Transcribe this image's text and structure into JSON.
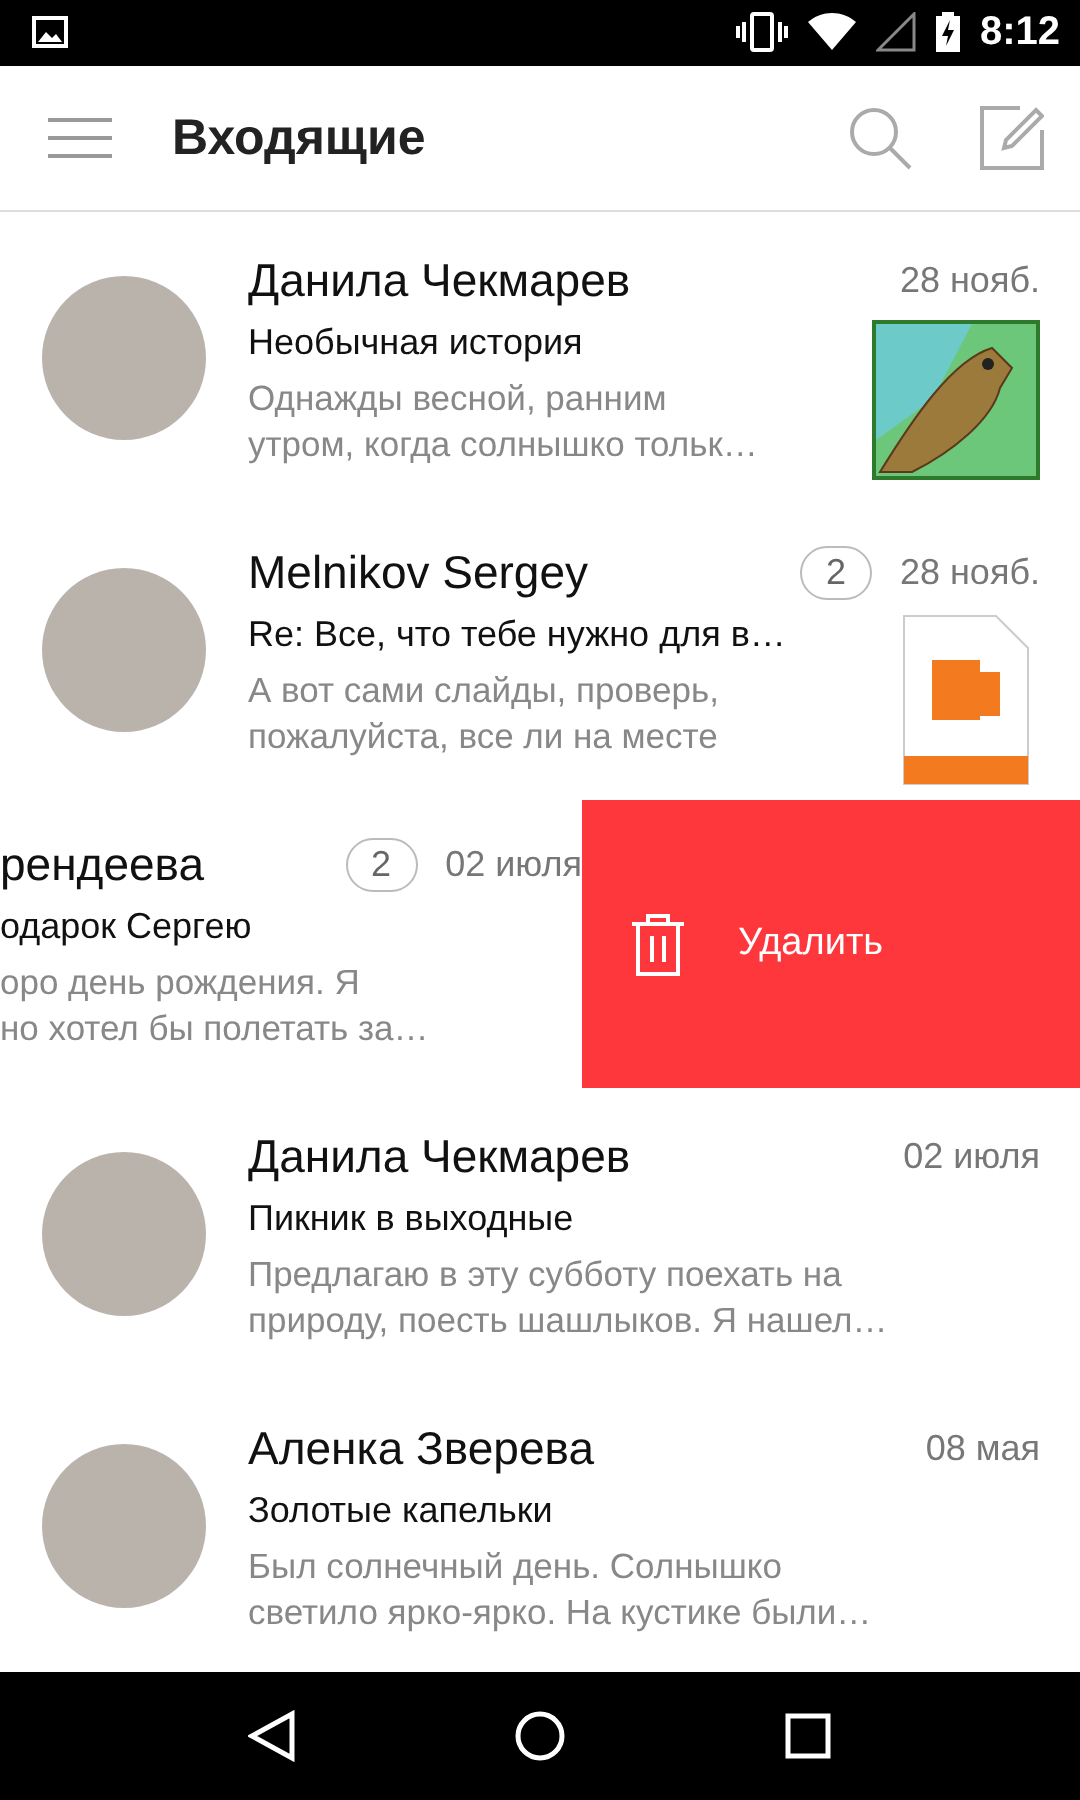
{
  "status_bar": {
    "time": "8:12"
  },
  "header": {
    "title": "Входящие"
  },
  "messages": [
    {
      "kind": "plain",
      "sender": "Данила Чекмарев",
      "date": "28 нояб.",
      "subject": "Необычная история",
      "preview_lines": [
        "Однажды весной, ранним",
        "утром, когда солнышко тольк…"
      ],
      "attachment": {
        "kind": "image"
      }
    },
    {
      "kind": "plain",
      "sender": "Melnikov Sergey",
      "count": "2",
      "date": "28 нояб.",
      "subject": "Re: Все, что тебе нужно для в…",
      "preview_lines": [
        "А вот сами слайды, проверь,",
        "пожалуйста, все ли на месте"
      ],
      "attachment": {
        "kind": "ppt"
      }
    },
    {
      "kind": "swiped",
      "sender": "рендеева",
      "count": "2",
      "date": "02 июля",
      "subject": "одарок Сергею",
      "preview_lines": [
        "оро день рождения. Я",
        "но хотел бы полетать за…"
      ],
      "action": "Удалить"
    },
    {
      "kind": "plain",
      "sender": "Данила Чекмарев",
      "date": "02 июля",
      "subject": "Пикник в выходные",
      "preview_lines": [
        "Предлагаю в эту субботу поехать на",
        "природу, поесть шашлыков. Я нашел…"
      ]
    },
    {
      "kind": "plain",
      "sender": "Аленка Зверева",
      "date": "08 мая",
      "subject": "Золотые капельки",
      "preview_lines": [
        "Был солнечный день. Солнышко",
        "светило ярко-ярко. На кустике были…"
      ]
    }
  ]
}
